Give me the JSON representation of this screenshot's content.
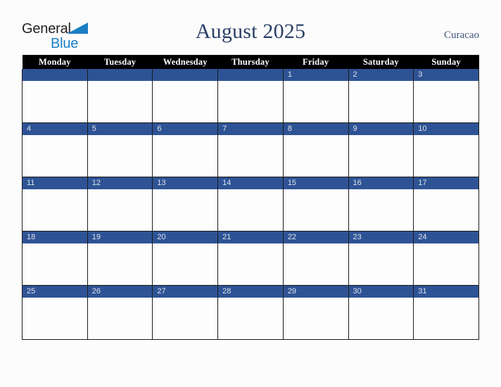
{
  "brand": {
    "name_part1": "General",
    "name_part2": "Blue",
    "triangle_icon": "triangle-icon",
    "color_dark": "#231f20",
    "color_blue": "#1b7fc4"
  },
  "header": {
    "title": "August 2025",
    "month": "August",
    "year": "2025",
    "country": "Curacao",
    "title_color": "#2a3f67"
  },
  "calendar": {
    "weekday_headers": [
      "Monday",
      "Tuesday",
      "Wednesday",
      "Thursday",
      "Friday",
      "Saturday",
      "Sunday"
    ],
    "header_bg": "#000000",
    "header_text_color": "#ffffff",
    "daybar_bg": "#2e5395",
    "daybar_text_color": "#dfe4ee",
    "cell_bg": "#fdfdfd",
    "grid_line_color": "#1b1b1b",
    "weeks": [
      {
        "days": [
          {
            "label": "",
            "empty": true,
            "events": ""
          },
          {
            "label": "",
            "empty": true,
            "events": ""
          },
          {
            "label": "",
            "empty": true,
            "events": ""
          },
          {
            "label": "",
            "empty": true,
            "events": ""
          },
          {
            "label": "1",
            "empty": false,
            "events": ""
          },
          {
            "label": "2",
            "empty": false,
            "events": ""
          },
          {
            "label": "3",
            "empty": false,
            "events": ""
          }
        ]
      },
      {
        "days": [
          {
            "label": "4",
            "empty": false,
            "events": ""
          },
          {
            "label": "5",
            "empty": false,
            "events": ""
          },
          {
            "label": "6",
            "empty": false,
            "events": ""
          },
          {
            "label": "7",
            "empty": false,
            "events": ""
          },
          {
            "label": "8",
            "empty": false,
            "events": ""
          },
          {
            "label": "9",
            "empty": false,
            "events": ""
          },
          {
            "label": "10",
            "empty": false,
            "events": ""
          }
        ]
      },
      {
        "days": [
          {
            "label": "11",
            "empty": false,
            "events": ""
          },
          {
            "label": "12",
            "empty": false,
            "events": ""
          },
          {
            "label": "13",
            "empty": false,
            "events": ""
          },
          {
            "label": "14",
            "empty": false,
            "events": ""
          },
          {
            "label": "15",
            "empty": false,
            "events": ""
          },
          {
            "label": "16",
            "empty": false,
            "events": ""
          },
          {
            "label": "17",
            "empty": false,
            "events": ""
          }
        ]
      },
      {
        "days": [
          {
            "label": "18",
            "empty": false,
            "events": ""
          },
          {
            "label": "19",
            "empty": false,
            "events": ""
          },
          {
            "label": "20",
            "empty": false,
            "events": ""
          },
          {
            "label": "21",
            "empty": false,
            "events": ""
          },
          {
            "label": "22",
            "empty": false,
            "events": ""
          },
          {
            "label": "23",
            "empty": false,
            "events": ""
          },
          {
            "label": "24",
            "empty": false,
            "events": ""
          }
        ]
      },
      {
        "days": [
          {
            "label": "25",
            "empty": false,
            "events": ""
          },
          {
            "label": "26",
            "empty": false,
            "events": ""
          },
          {
            "label": "27",
            "empty": false,
            "events": ""
          },
          {
            "label": "28",
            "empty": false,
            "events": ""
          },
          {
            "label": "29",
            "empty": false,
            "events": ""
          },
          {
            "label": "30",
            "empty": false,
            "events": ""
          },
          {
            "label": "31",
            "empty": false,
            "events": ""
          }
        ]
      }
    ]
  }
}
